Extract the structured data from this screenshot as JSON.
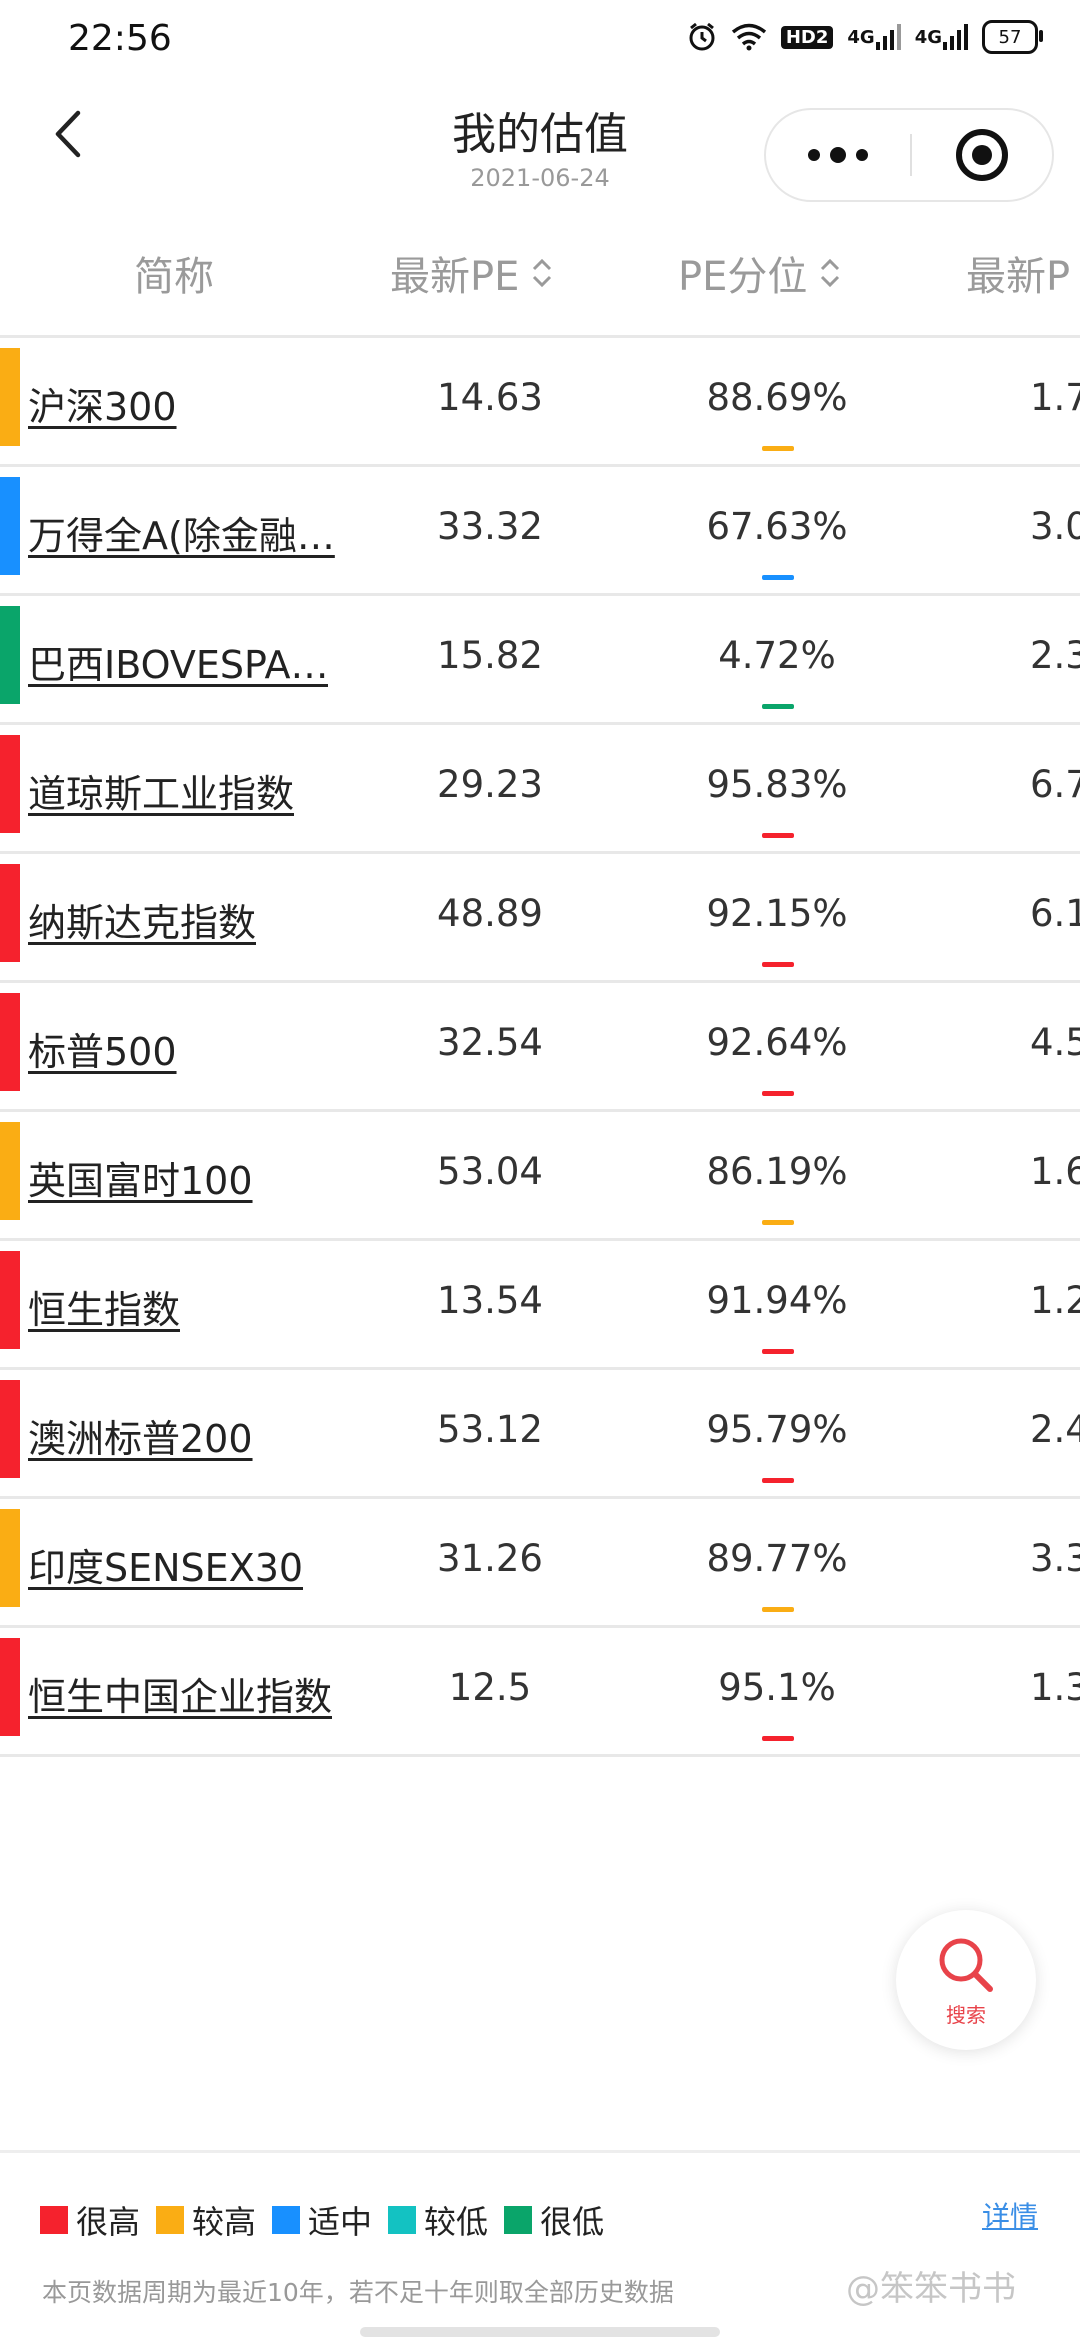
{
  "status_bar": {
    "time": "22:56",
    "hd_label": "HD2",
    "signal_1": "4G",
    "signal_2": "4G",
    "battery": "57"
  },
  "nav": {
    "title": "我的估值",
    "date": "2021-06-24"
  },
  "table": {
    "headers": {
      "name": "简称",
      "pe": "最新PE",
      "pe_percentile": "PE分位",
      "pb": "最新P"
    },
    "rows": [
      {
        "name": "沪深300",
        "pe": "14.63",
        "pct": "88.69%",
        "pb": "1.7",
        "level": "较高"
      },
      {
        "name": "万得全A(除金融…",
        "pe": "33.32",
        "pct": "67.63%",
        "pb": "3.0",
        "level": "适中"
      },
      {
        "name": "巴西IBOVESPA…",
        "pe": "15.82",
        "pct": "4.72%",
        "pb": "2.3",
        "level": "很低"
      },
      {
        "name": "道琼斯工业指数",
        "pe": "29.23",
        "pct": "95.83%",
        "pb": "6.7",
        "level": "很高"
      },
      {
        "name": "纳斯达克指数",
        "pe": "48.89",
        "pct": "92.15%",
        "pb": "6.1",
        "level": "很高"
      },
      {
        "name": "标普500",
        "pe": "32.54",
        "pct": "92.64%",
        "pb": "4.5",
        "level": "很高"
      },
      {
        "name": "英国富时100",
        "pe": "53.04",
        "pct": "86.19%",
        "pb": "1.6",
        "level": "较高"
      },
      {
        "name": "恒生指数",
        "pe": "13.54",
        "pct": "91.94%",
        "pb": "1.2",
        "level": "很高"
      },
      {
        "name": "澳洲标普200",
        "pe": "53.12",
        "pct": "95.79%",
        "pb": "2.4",
        "level": "很高"
      },
      {
        "name": "印度SENSEX30",
        "pe": "31.26",
        "pct": "89.77%",
        "pb": "3.3",
        "level": "较高"
      },
      {
        "name": "恒生中国企业指数",
        "pe": "12.5",
        "pct": "95.1%",
        "pb": "1.3",
        "level": "很高"
      }
    ]
  },
  "level_colors": {
    "很高": "#f5222d",
    "较高": "#faad14",
    "适中": "#1890ff",
    "较低": "#13c2c2",
    "很低": "#0aa56a"
  },
  "search_fab": {
    "label": "搜索",
    "icon": "search-icon"
  },
  "footer": {
    "legend": [
      "很高",
      "较高",
      "适中",
      "较低",
      "很低"
    ],
    "detail_link": "详情",
    "note": "本页数据周期为最近10年，若不足十年则取全部历史数据",
    "watermark": "@笨笨书书"
  }
}
